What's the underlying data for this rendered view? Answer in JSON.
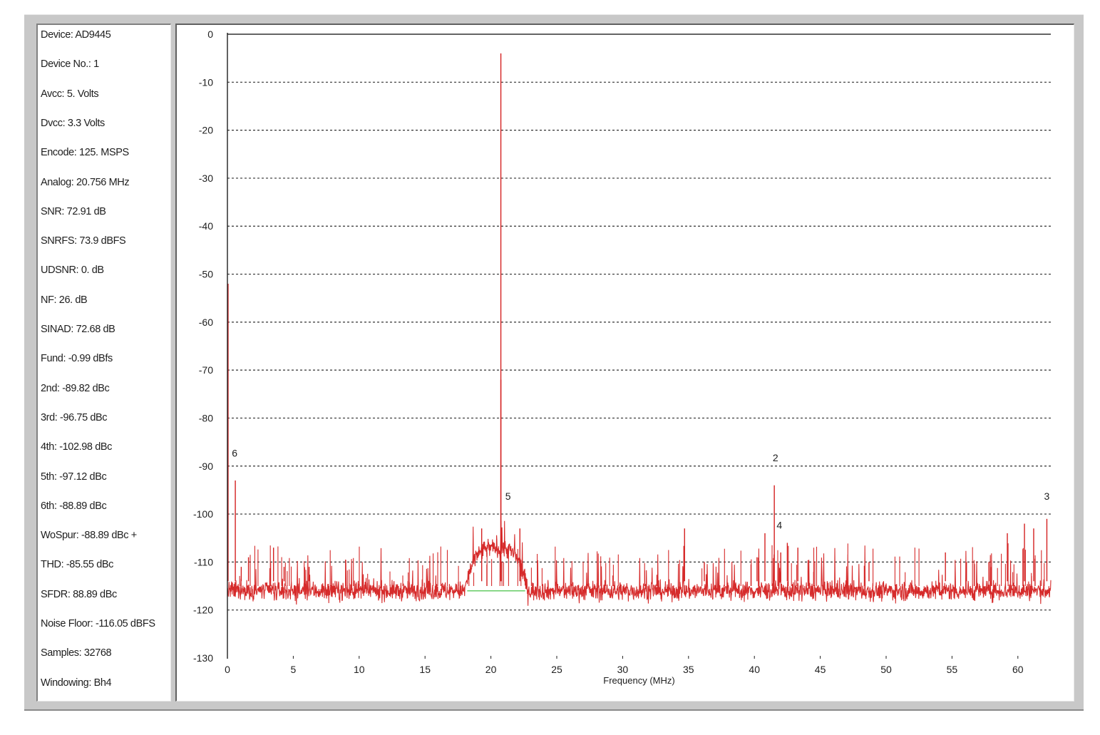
{
  "stats": [
    "Device: AD9445",
    "Device No.: 1",
    "Avcc: 5. Volts",
    "Dvcc: 3.3 Volts",
    "Encode: 125. MSPS",
    "Analog: 20.756 MHz",
    "SNR: 72.91 dB",
    "SNRFS: 73.9 dBFS",
    "UDSNR: 0. dB",
    "NF: 26. dB",
    "SINAD: 72.68 dB",
    "Fund: -0.99 dBfs",
    "2nd: -89.82 dBc",
    "3rd: -96.75 dBc",
    "4th: -102.98 dBc",
    "5th: -97.12 dBc",
    "6th: -88.89 dBc",
    "WoSpur: -88.89 dBc +",
    "THD: -85.55 dBc",
    "SFDR: 88.89 dBc",
    "Noise Floor: -116.05 dBFS",
    "Samples: 32768",
    "Windowing: Bh4"
  ],
  "chart_data": {
    "type": "line",
    "title": "",
    "xlabel": "Frequency (MHz)",
    "ylabel": "",
    "xlim": [
      0,
      62.5
    ],
    "ylim": [
      -130,
      0
    ],
    "grid": true,
    "x_ticks": [
      0,
      5,
      10,
      15,
      20,
      25,
      30,
      35,
      40,
      45,
      50,
      55,
      60
    ],
    "y_ticks": [
      0,
      -10,
      -20,
      -30,
      -40,
      -50,
      -60,
      -70,
      -80,
      -90,
      -100,
      -110,
      -120,
      -130
    ],
    "trace_color": "#d42020",
    "grid_color": "#303030",
    "noise_floor_marker": {
      "x": [
        18.2,
        22.6
      ],
      "y": -116,
      "color": "#66cc66"
    },
    "noise_floor_level": -116,
    "noise_hump": {
      "x": [
        18.0,
        22.8
      ],
      "peak": -107
    },
    "series": [
      {
        "peaks": [
          {
            "x": 0.05,
            "y": -52
          },
          {
            "x": 0.6,
            "y": -93
          },
          {
            "x": 1.05,
            "y": -111
          },
          {
            "x": 1.6,
            "y": -109
          },
          {
            "x": 3.5,
            "y": -107
          },
          {
            "x": 4.3,
            "y": -111
          },
          {
            "x": 6.2,
            "y": -111
          },
          {
            "x": 20.756,
            "y": -4
          },
          {
            "x": 20.756,
            "y": -72
          },
          {
            "x": 19.3,
            "y": -103
          },
          {
            "x": 22.2,
            "y": -103
          },
          {
            "x": 34.7,
            "y": -103
          },
          {
            "x": 36.2,
            "y": -110
          },
          {
            "x": 40.2,
            "y": -109
          },
          {
            "x": 40.8,
            "y": -104
          },
          {
            "x": 41.512,
            "y": -94
          },
          {
            "x": 42.0,
            "y": -108
          },
          {
            "x": 42.5,
            "y": -106
          },
          {
            "x": 43.3,
            "y": -107
          },
          {
            "x": 48.7,
            "y": -110
          },
          {
            "x": 54.5,
            "y": -108
          },
          {
            "x": 56.1,
            "y": -110
          },
          {
            "x": 57.8,
            "y": -110
          },
          {
            "x": 59.2,
            "y": -104
          },
          {
            "x": 60.5,
            "y": -102
          },
          {
            "x": 61.2,
            "y": -103
          },
          {
            "x": 62.2,
            "y": -101
          }
        ]
      }
    ],
    "harmonic_labels": [
      {
        "label": "6",
        "x": 0.55,
        "y": -88
      },
      {
        "label": "5",
        "x": 21.3,
        "y": -97
      },
      {
        "label": "2",
        "x": 41.6,
        "y": -89
      },
      {
        "label": "4",
        "x": 41.9,
        "y": -103
      },
      {
        "label": "3",
        "x": 62.2,
        "y": -97
      }
    ]
  }
}
